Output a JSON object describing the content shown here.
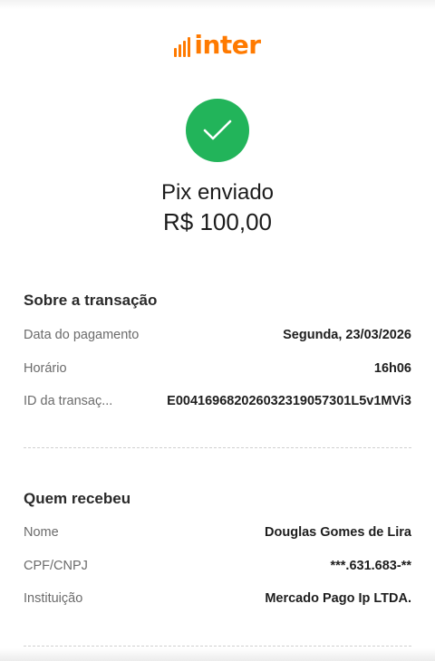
{
  "brand": {
    "name": "inter",
    "color": "#ff7a00"
  },
  "status": {
    "icon": "checkmark-icon",
    "color": "#22b45a"
  },
  "headline": "Pix enviado",
  "amount": "R$ 100,00",
  "transaction": {
    "title": "Sobre a transação",
    "rows": [
      {
        "label": "Data do pagamento",
        "value": "Segunda, 23/03/2026"
      },
      {
        "label": "Horário",
        "value": "16h06"
      },
      {
        "label": "ID da transaç...",
        "value": "E004169682026032319057301L5v1MVi3"
      }
    ]
  },
  "recipient": {
    "title": "Quem recebeu",
    "rows": [
      {
        "label": "Nome",
        "value": "Douglas Gomes de Lira"
      },
      {
        "label": "CPF/CNPJ",
        "value": "***.631.683-**"
      },
      {
        "label": "Instituição",
        "value": "Mercado Pago Ip LTDA."
      }
    ]
  }
}
